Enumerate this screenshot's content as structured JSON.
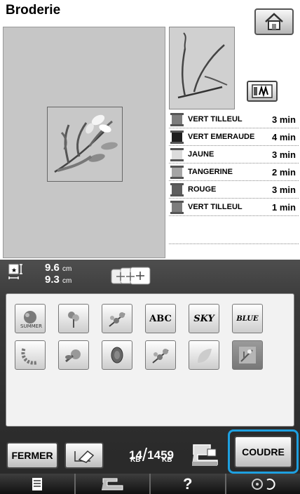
{
  "header": {
    "title": "Broderie"
  },
  "design": {
    "width": "9.6",
    "height": "9.3",
    "unit": "cm"
  },
  "thread_colors": [
    {
      "name": "VERT TILLEUL",
      "time": "3 min",
      "color": "#7d7d7d"
    },
    {
      "name": "VERT EMERAUDE",
      "time": "4 min",
      "color": "#1e1e1e"
    },
    {
      "name": "JAUNE",
      "time": "3 min",
      "color": "#dcdcdc"
    },
    {
      "name": "TANGERINE",
      "time": "2 min",
      "color": "#a5a5a5"
    },
    {
      "name": "ROUGE",
      "time": "3 min",
      "color": "#5e5e5e"
    },
    {
      "name": "VERT TILLEUL",
      "time": "1 min",
      "color": "#7d7d7d"
    }
  ],
  "patterns": {
    "row1": [
      {
        "icon": "summer-pattern-icon",
        "label": ""
      },
      {
        "icon": "flower-pattern-icon",
        "label": ""
      },
      {
        "icon": "floral-spray-pattern-icon",
        "label": ""
      },
      {
        "icon": "abc-text-pattern-icon",
        "label": "ABC"
      },
      {
        "icon": "sky-text-pattern-icon",
        "label": "SKY"
      },
      {
        "icon": "blue-text-pattern-icon",
        "label": "BLUE"
      }
    ],
    "row2": [
      {
        "icon": "wreath-pattern-icon",
        "label": ""
      },
      {
        "icon": "rose-pattern-icon",
        "label": ""
      },
      {
        "icon": "oval-pattern-icon",
        "label": ""
      },
      {
        "icon": "floral-spray-pattern-icon",
        "label": ""
      },
      {
        "icon": "leaf-pattern-icon",
        "label": ""
      },
      {
        "icon": "branch-pattern-icon",
        "label": ""
      }
    ]
  },
  "toolbar": {
    "close_label": "FERMER",
    "sew_label": "COUDRE",
    "memory_used": "14",
    "memory_total": "1459",
    "memory_unit": "KB"
  },
  "nav": {
    "help_label": "?"
  }
}
